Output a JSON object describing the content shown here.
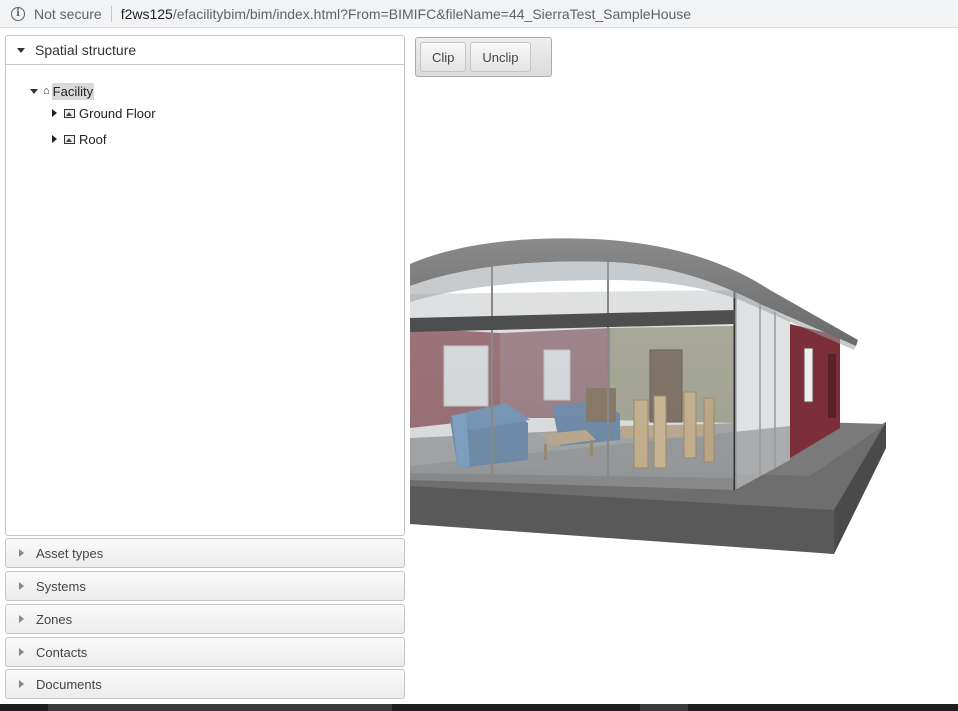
{
  "browser": {
    "security_label": "Not secure",
    "url_host": "f2ws125",
    "url_path": "/efacilitybim/bim/index.html?From=BIMIFC&fileName=44_SierraTest_SampleHouse"
  },
  "sidebar": {
    "spatial": {
      "title": "Spatial structure",
      "tree": {
        "root_label": "Facility",
        "children": [
          {
            "label": "Ground Floor"
          },
          {
            "label": "Roof"
          }
        ]
      }
    },
    "sections": [
      {
        "label": "Asset types"
      },
      {
        "label": "Systems"
      },
      {
        "label": "Zones"
      },
      {
        "label": "Contacts"
      },
      {
        "label": "Documents"
      }
    ]
  },
  "toolbar": {
    "clip_label": "Clip",
    "unclip_label": "Unclip"
  },
  "colors": {
    "accent": "#d9d9d9",
    "wall_red": "#8a3a44",
    "sofa_blue": "#3f6e9e",
    "wood": "#d6ae6e",
    "slab": "#555555"
  }
}
